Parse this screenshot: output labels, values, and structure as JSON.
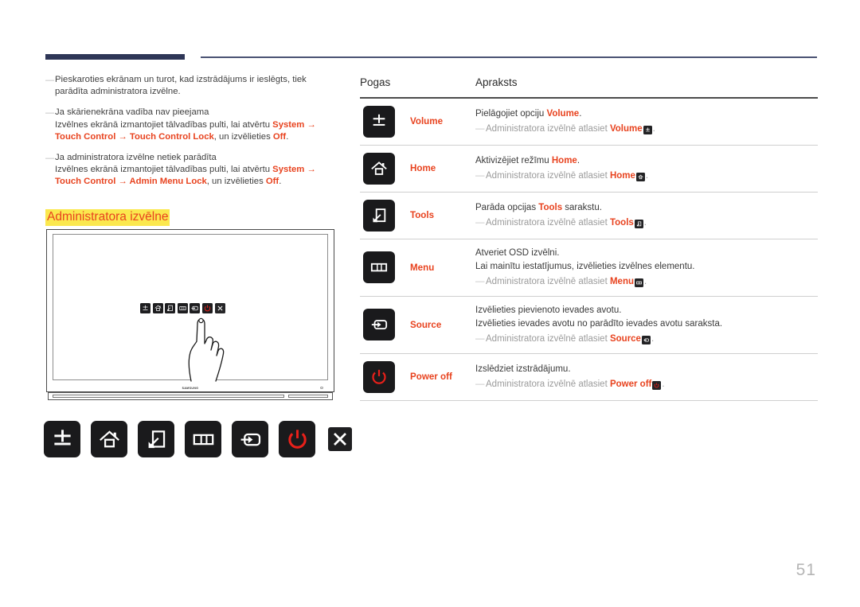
{
  "page": {
    "number": "51"
  },
  "notes": [
    {
      "line1": "Pieskaroties ekrānam un turot, kad izstrādājums ir ieslēgts, tiek parādīta administratora izvēlne.",
      "line2": ""
    },
    {
      "line1": "Ja skārienekrāna vadība nav pieejama",
      "line2_pre": "Izvēlnes ekrānā izmantojiet tālvadības pulti, lai atvērtu ",
      "kw1": "System",
      "arrow1": " → ",
      "kw2": "Touch Control",
      "arrow2": " → ",
      "kw3": "Touch Control Lock",
      "mid": ", un izvēlieties ",
      "kw4": "Off",
      "end": "."
    },
    {
      "line1": "Ja administratora izvēlne netiek parādīta",
      "line2_pre": "Izvēlnes ekrānā izmantojiet tālvadības pulti, lai atvērtu ",
      "kw1": "System",
      "arrow1": " → ",
      "kw2": "Touch Control",
      "arrow2": " → ",
      "kw3": "Admin Menu Lock",
      "mid": ", un izvēlieties ",
      "kw4": "Off",
      "end": "."
    }
  ],
  "section_title": "Administratora izvēlne",
  "illustration": {
    "brand": "SAMSUNG",
    "osd_buttons": [
      "volume-icon",
      "home-icon",
      "tools-icon",
      "menu-icon",
      "source-icon",
      "power-icon",
      "close-icon"
    ]
  },
  "button_strip": [
    "volume-icon",
    "home-icon",
    "tools-icon",
    "menu-icon",
    "source-icon",
    "power-icon",
    "close-icon"
  ],
  "table": {
    "header": {
      "buttons": "Pogas",
      "description": "Apraksts"
    },
    "rows": [
      {
        "icon": "volume-icon",
        "label": "Volume",
        "main_pre": "Pielāgojiet opciju ",
        "main_kw": "Volume",
        "main_post": ".",
        "main2": "",
        "sub_pre": "Administratora izvēlnē atlasiet ",
        "sub_kw": "Volume",
        "sub_icon": "volume-icon",
        "sub_post": "."
      },
      {
        "icon": "home-icon",
        "label": "Home",
        "main_pre": "Aktivizējiet režīmu ",
        "main_kw": "Home",
        "main_post": ".",
        "main2": "",
        "sub_pre": "Administratora izvēlnē atlasiet ",
        "sub_kw": "Home",
        "sub_icon": "home-icon",
        "sub_post": "."
      },
      {
        "icon": "tools-icon",
        "label": "Tools",
        "main_pre": "Parāda opcijas ",
        "main_kw": "Tools",
        "main_post": " sarakstu.",
        "main2": "",
        "sub_pre": "Administratora izvēlnē atlasiet ",
        "sub_kw": "Tools",
        "sub_icon": "tools-icon",
        "sub_post": "."
      },
      {
        "icon": "menu-icon",
        "label": "Menu",
        "main_pre": "Atveriet OSD izvēlni.",
        "main_kw": "",
        "main_post": "",
        "main2": "Lai mainītu iestatījumus, izvēlieties izvēlnes elementu.",
        "sub_pre": "Administratora izvēlnē atlasiet ",
        "sub_kw": "Menu",
        "sub_icon": "menu-icon",
        "sub_post": "."
      },
      {
        "icon": "source-icon",
        "label": "Source",
        "main_pre": "Izvēlieties pievienoto ievades avotu.",
        "main_kw": "",
        "main_post": "",
        "main2": "Izvēlieties ievades avotu no parādīto ievades avotu saraksta.",
        "sub_pre": "Administratora izvēlnē atlasiet ",
        "sub_kw": "Source",
        "sub_icon": "source-icon",
        "sub_post": "."
      },
      {
        "icon": "power-icon",
        "label": "Power off",
        "main_pre": "Izslēdziet izstrādājumu.",
        "main_kw": "",
        "main_post": "",
        "main2": "",
        "sub_pre": "Administratora izvēlnē atlasiet ",
        "sub_kw": "Power off",
        "sub_icon": "power-icon",
        "sub_post": "."
      }
    ]
  },
  "colors": {
    "accent": "#e8431f",
    "rule": "#2e3657",
    "highlight": "#fbe84e",
    "button_bg": "#1a1a1c",
    "power_red": "#e8201a"
  }
}
